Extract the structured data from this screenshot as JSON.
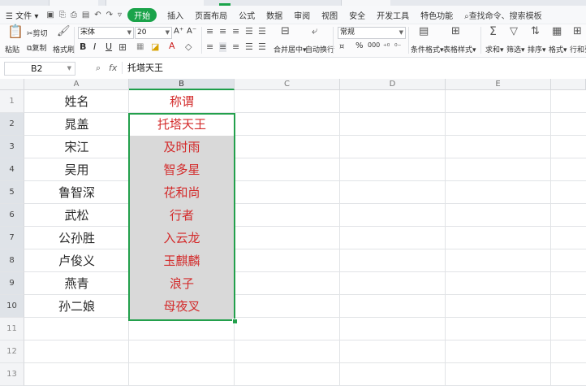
{
  "menubar": {
    "file": "文件",
    "start": "开始",
    "tabs": [
      "插入",
      "页面布局",
      "公式",
      "数据",
      "审阅",
      "视图",
      "安全",
      "开发工具",
      "特色功能"
    ],
    "search": "查找命令、搜索模板"
  },
  "toolbar": {
    "paste": "粘贴",
    "cut": "剪切",
    "copy": "复制",
    "format_painter": "格式刷",
    "font_name": "宋体",
    "font_size": "20",
    "bold": "B",
    "italic": "I",
    "underline": "U",
    "grow_font": "A⁺",
    "shrink_font": "A⁻",
    "merge_center": "合并居中",
    "wrap_text": "自动换行",
    "number_format": "常规",
    "percent": "%",
    "thousands": "000",
    "cond_format": "条件格式",
    "table_style": "表格样式",
    "sum": "求和",
    "filter": "筛选",
    "sort": "排序",
    "format": "格式",
    "row_col": "行和列"
  },
  "formula_bar": {
    "cell_ref": "B2",
    "fx": "fx",
    "content": "托塔天王"
  },
  "sheet": {
    "columns": [
      "A",
      "B",
      "C",
      "D",
      "E"
    ],
    "rows": [
      "1",
      "2",
      "3",
      "4",
      "5",
      "6",
      "7",
      "8",
      "9",
      "10",
      "11",
      "12",
      "13"
    ],
    "col_a": [
      "姓名",
      "晁盖",
      "宋江",
      "吴用",
      "鲁智深",
      "武松",
      "公孙胜",
      "卢俊义",
      "燕青",
      "孙二娘"
    ],
    "col_b": [
      "称谓",
      "托塔天王",
      "及时雨",
      "智多星",
      "花和尚",
      "行者",
      "入云龙",
      "玉麒麟",
      "浪子",
      "母夜叉"
    ]
  },
  "colors": {
    "accent_green": "#1aa34a",
    "text_red": "#d32b2b",
    "selection_fill": "#d9d9d9"
  }
}
